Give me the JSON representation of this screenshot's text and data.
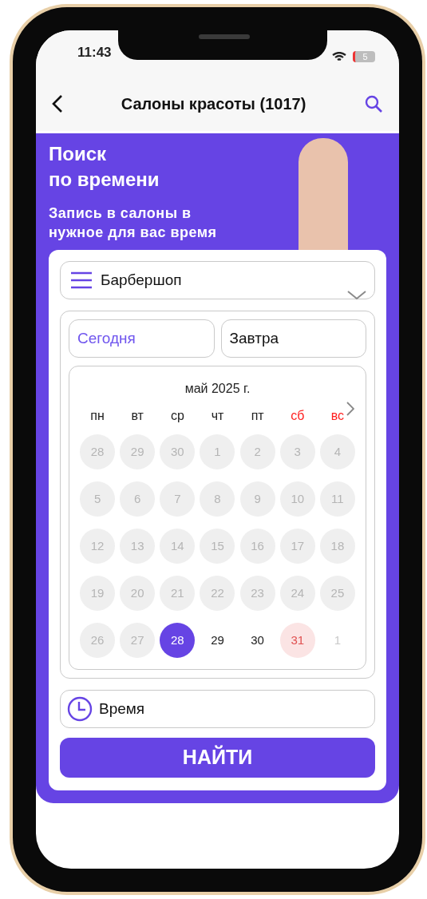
{
  "status_bar": {
    "time": "11:43",
    "battery": "5"
  },
  "nav": {
    "title": "Салоны красоты (1017)"
  },
  "banner": {
    "title_lines": [
      "Поиск",
      "по времени"
    ],
    "subtitle_lines": [
      "Запись в  салоны в",
      "нужное для вас время"
    ]
  },
  "category_select": {
    "value": "Барбершоп"
  },
  "day_tabs": [
    {
      "label": "Сегодня",
      "selected": true
    },
    {
      "label": "Завтра",
      "selected": false
    }
  ],
  "calendar": {
    "month": "май 2025 г.",
    "weekdays": [
      {
        "label": "пн",
        "weekend": false
      },
      {
        "label": "вт",
        "weekend": false
      },
      {
        "label": "ср",
        "weekend": false
      },
      {
        "label": "чт",
        "weekend": false
      },
      {
        "label": "пт",
        "weekend": false
      },
      {
        "label": "сб",
        "weekend": true
      },
      {
        "label": "вс",
        "weekend": true
      }
    ],
    "days": [
      {
        "label": "28",
        "kind": "past"
      },
      {
        "label": "29",
        "kind": "past"
      },
      {
        "label": "30",
        "kind": "past"
      },
      {
        "label": "1",
        "kind": "past"
      },
      {
        "label": "2",
        "kind": "past"
      },
      {
        "label": "3",
        "kind": "past"
      },
      {
        "label": "4",
        "kind": "past"
      },
      {
        "label": "5",
        "kind": "past"
      },
      {
        "label": "6",
        "kind": "past"
      },
      {
        "label": "7",
        "kind": "past"
      },
      {
        "label": "8",
        "kind": "past"
      },
      {
        "label": "9",
        "kind": "past"
      },
      {
        "label": "10",
        "kind": "past"
      },
      {
        "label": "11",
        "kind": "past"
      },
      {
        "label": "12",
        "kind": "past"
      },
      {
        "label": "13",
        "kind": "past"
      },
      {
        "label": "14",
        "kind": "past"
      },
      {
        "label": "15",
        "kind": "past"
      },
      {
        "label": "16",
        "kind": "past"
      },
      {
        "label": "17",
        "kind": "past"
      },
      {
        "label": "18",
        "kind": "past"
      },
      {
        "label": "19",
        "kind": "past"
      },
      {
        "label": "20",
        "kind": "past"
      },
      {
        "label": "21",
        "kind": "past"
      },
      {
        "label": "22",
        "kind": "past"
      },
      {
        "label": "23",
        "kind": "past"
      },
      {
        "label": "24",
        "kind": "past"
      },
      {
        "label": "25",
        "kind": "past"
      },
      {
        "label": "26",
        "kind": "past"
      },
      {
        "label": "27",
        "kind": "past"
      },
      {
        "label": "28",
        "kind": "selected"
      },
      {
        "label": "29",
        "kind": "available"
      },
      {
        "label": "30",
        "kind": "available"
      },
      {
        "label": "31",
        "kind": "holiday"
      },
      {
        "label": "1",
        "kind": "next_month"
      }
    ]
  },
  "time_select": {
    "value": "Время"
  },
  "search_button": {
    "label": "НАЙТИ"
  }
}
